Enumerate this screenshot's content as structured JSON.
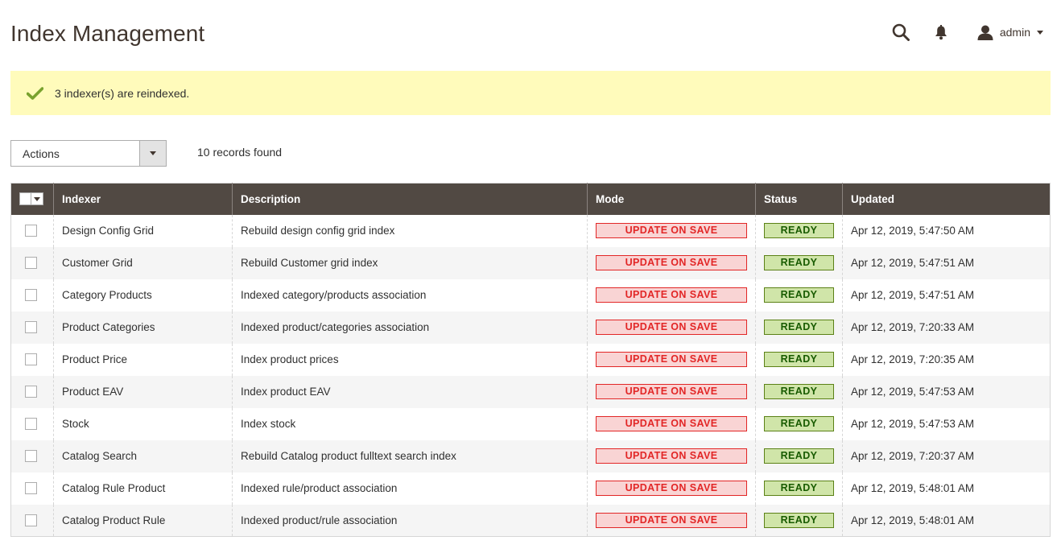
{
  "page": {
    "title": "Index Management"
  },
  "header": {
    "user_name": "admin"
  },
  "message": {
    "text": "3 indexer(s) are reindexed."
  },
  "toolbar": {
    "actions_label": "Actions",
    "records_found": "10 records found"
  },
  "grid": {
    "columns": {
      "indexer": "Indexer",
      "description": "Description",
      "mode": "Mode",
      "status": "Status",
      "updated": "Updated"
    },
    "rows": [
      {
        "indexer": "Design Config Grid",
        "description": "Rebuild design config grid index",
        "mode": "UPDATE ON SAVE",
        "status": "READY",
        "updated": "Apr 12, 2019, 5:47:50 AM"
      },
      {
        "indexer": "Customer Grid",
        "description": "Rebuild Customer grid index",
        "mode": "UPDATE ON SAVE",
        "status": "READY",
        "updated": "Apr 12, 2019, 5:47:51 AM"
      },
      {
        "indexer": "Category Products",
        "description": "Indexed category/products association",
        "mode": "UPDATE ON SAVE",
        "status": "READY",
        "updated": "Apr 12, 2019, 5:47:51 AM"
      },
      {
        "indexer": "Product Categories",
        "description": "Indexed product/categories association",
        "mode": "UPDATE ON SAVE",
        "status": "READY",
        "updated": "Apr 12, 2019, 7:20:33 AM"
      },
      {
        "indexer": "Product Price",
        "description": "Index product prices",
        "mode": "UPDATE ON SAVE",
        "status": "READY",
        "updated": "Apr 12, 2019, 7:20:35 AM"
      },
      {
        "indexer": "Product EAV",
        "description": "Index product EAV",
        "mode": "UPDATE ON SAVE",
        "status": "READY",
        "updated": "Apr 12, 2019, 5:47:53 AM"
      },
      {
        "indexer": "Stock",
        "description": "Index stock",
        "mode": "UPDATE ON SAVE",
        "status": "READY",
        "updated": "Apr 12, 2019, 5:47:53 AM"
      },
      {
        "indexer": "Catalog Search",
        "description": "Rebuild Catalog product fulltext search index",
        "mode": "UPDATE ON SAVE",
        "status": "READY",
        "updated": "Apr 12, 2019, 7:20:37 AM"
      },
      {
        "indexer": "Catalog Rule Product",
        "description": "Indexed rule/product association",
        "mode": "UPDATE ON SAVE",
        "status": "READY",
        "updated": "Apr 12, 2019, 5:48:01 AM"
      },
      {
        "indexer": "Catalog Product Rule",
        "description": "Indexed product/rule association",
        "mode": "UPDATE ON SAVE",
        "status": "READY",
        "updated": "Apr 12, 2019, 5:48:01 AM"
      }
    ]
  },
  "colors": {
    "header_bg": "#514943",
    "message_bg": "#fffbbb",
    "mode_red": "#e22626",
    "status_green": "#185b00",
    "check_green": "#79a22e"
  },
  "icons": {
    "search": "search-icon",
    "bell": "bell-icon",
    "user": "user-icon",
    "check": "check-icon"
  }
}
